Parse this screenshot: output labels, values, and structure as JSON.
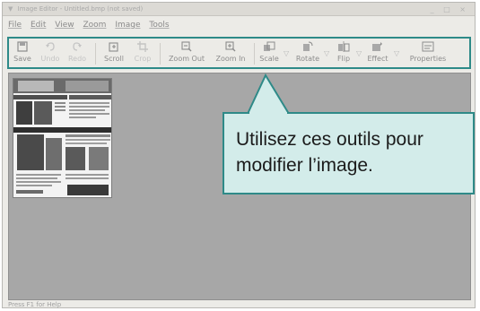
{
  "window": {
    "title": "Image Editor - Untitled.bmp (not saved)",
    "controls": [
      "_",
      "□",
      "×"
    ]
  },
  "menu": {
    "items": [
      "File",
      "Edit",
      "View",
      "Zoom",
      "Image",
      "Tools"
    ]
  },
  "toolbar": {
    "save": "Save",
    "undo": "Undo",
    "redo": "Redo",
    "scroll": "Scroll",
    "crop": "Crop",
    "zoom_out": "Zoom Out",
    "zoom_in": "Zoom In",
    "scale": "Scale",
    "rotate": "Rotate",
    "flip": "Flip",
    "effect": "Effect",
    "properties": "Properties",
    "disabled": [
      "undo",
      "redo",
      "crop"
    ],
    "highlight_color": "#2e8a88"
  },
  "callout": {
    "line1": "Utilisez ces outils pour",
    "line2": "modifier l’image.",
    "background": "#d3ecea",
    "border": "#2e8a88"
  },
  "status": {
    "text": "Press F1 for Help"
  }
}
